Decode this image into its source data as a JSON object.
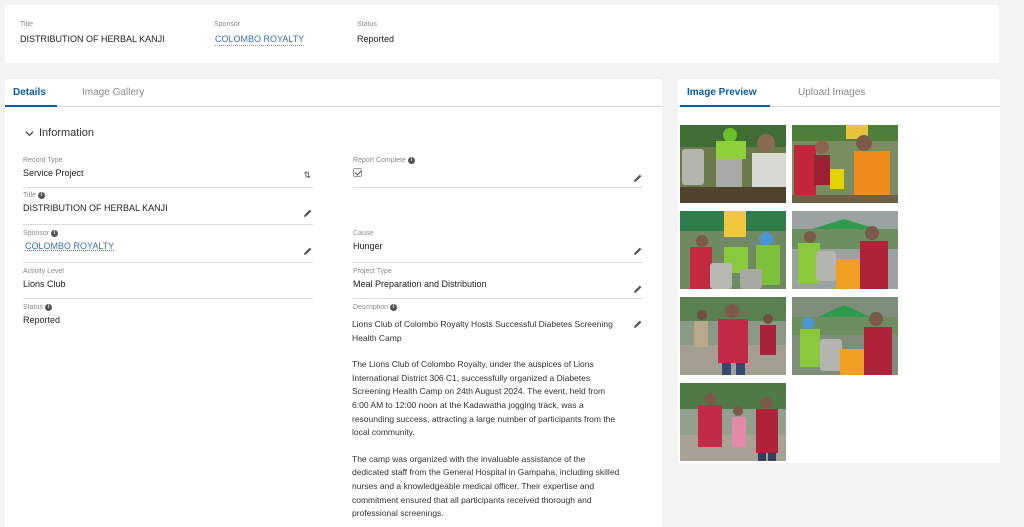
{
  "highlights": {
    "title_label": "Title",
    "title_value": "DISTRIBUTION OF HERBAL KANJI",
    "sponsor_label": "Sponsor",
    "sponsor_value": "COLOMBO ROYALTY",
    "status_label": "Status",
    "status_value": "Reported"
  },
  "tabs": {
    "details": "Details",
    "gallery": "Image Gallery"
  },
  "section": {
    "title": "Information"
  },
  "fields": {
    "record_type_label": "Record Type",
    "record_type_value": "Service Project",
    "report_complete_label": "Report Complete",
    "title_label": "Title",
    "title_value": "DISTRIBUTION OF HERBAL KANJI",
    "sponsor_label": "Sponsor",
    "sponsor_value": "COLOMBO ROYALTY",
    "cause_label": "Cause",
    "cause_value": "Hunger",
    "activity_label": "Activity Level",
    "activity_value": "Lions Club",
    "project_type_label": "Project Type",
    "project_type_value": "Meal Preparation and Distribution",
    "status_label": "Status",
    "status_value": "Reported",
    "description_label": "Description"
  },
  "description": {
    "heading": "Lions Club of Colombo Royalty Hosts Successful Diabetes Screening Health Camp",
    "p1": "The Lions Club of Colombo Royalty, under the auspices of Lions International District 306 C1, successfully organized a Diabetes Screening Health Camp on 24th August 2024. The event, held from 6:00 AM to 12:00 noon at the Kadawatha jogging track, was a resounding success, attracting a large number of participants from the local community.",
    "p2": "The camp was organized with the invaluable assistance of the dedicated staff from the General Hospital in Gampaha, including skilled nurses and a knowledgeable medical officer. Their expertise and commitment ensured that all participants received thorough and professional screenings."
  },
  "side_tabs": {
    "preview": "Image Preview",
    "upload": "Upload Images"
  },
  "icons": {
    "chevron": "chevron-down-icon",
    "edit": "pencil-icon",
    "sort": "swap-icon",
    "info": "info-icon"
  },
  "colors": {
    "accent": "#0b5cab",
    "link": "#3d6fb0"
  }
}
